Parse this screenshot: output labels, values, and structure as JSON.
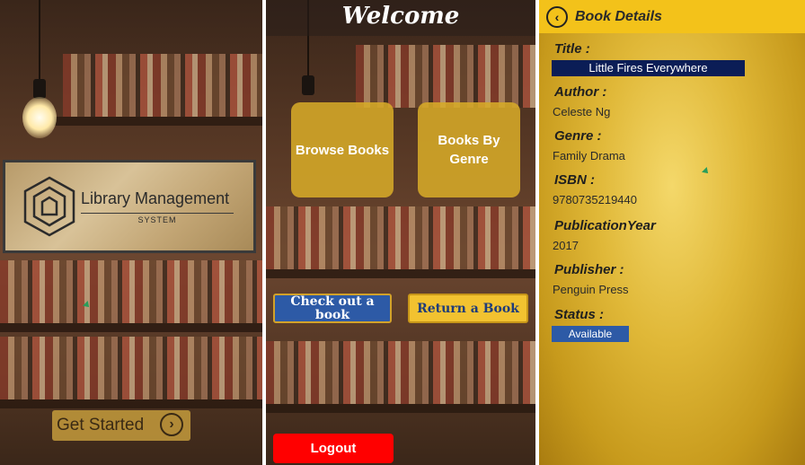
{
  "screen1": {
    "logo_title": "Library Management",
    "logo_subtitle": "SYSTEM",
    "get_started_label": "Get Started",
    "arrow_icon": "chevron-right-icon"
  },
  "screen2": {
    "welcome_title": "Welcome",
    "browse_books_label": "Browse Books",
    "books_by_genre_label": "Books By Genre",
    "checkout_label": "Check out a book",
    "return_label": "Return a Book",
    "logout_label": "Logout",
    "colors": {
      "tile": "#d6aa28",
      "checkout": "#2d5aa6",
      "return": "#f2c230",
      "logout": "#ff0000"
    }
  },
  "screen3": {
    "header_title": "Book Details",
    "back_icon": "chevron-left-icon",
    "fields": {
      "title_label": "Title :",
      "title_value": "Little Fires Everywhere",
      "author_label": "Author :",
      "author_value": "Celeste Ng",
      "genre_label": "Genre :",
      "genre_value": "Family Drama",
      "isbn_label": "ISBN :",
      "isbn_value": "9780735219440",
      "pubyear_label": "PublicationYear",
      "pubyear_value": "2017",
      "publisher_label": "Publisher :",
      "publisher_value": "Penguin Press",
      "status_label": "Status :",
      "status_value": "Available"
    }
  }
}
